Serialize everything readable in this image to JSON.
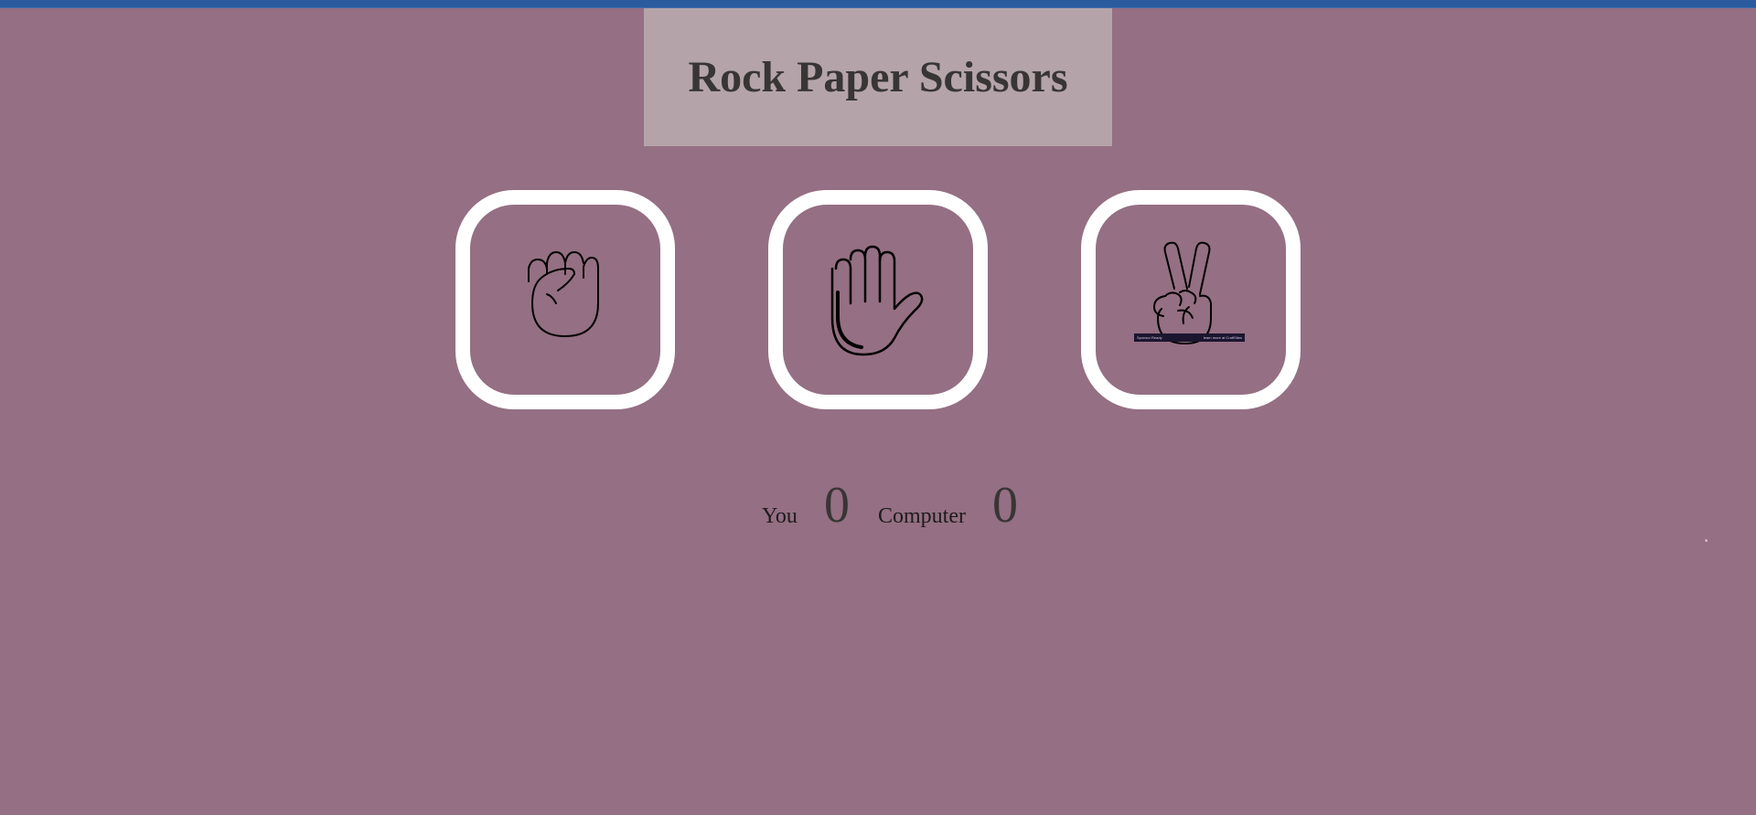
{
  "header": {
    "title": "Rock Paper Scissors"
  },
  "choices": [
    {
      "id": "rock",
      "icon": "raised-fist-icon"
    },
    {
      "id": "paper",
      "icon": "raised-hand-icon"
    },
    {
      "id": "scissors",
      "icon": "victory-hand-icon"
    }
  ],
  "sponsor": {
    "left_text": "Sponsor Ready",
    "right_text": "learn more at CraftSites"
  },
  "score": {
    "you_label": "You",
    "you_value": "0",
    "computer_label": "Computer",
    "computer_value": "0"
  },
  "colors": {
    "background": "#956f83",
    "title_panel": "#b4a4aa",
    "title_text": "#383535",
    "choice_border": "#ffffff",
    "top_strip": "#2a5b9f"
  }
}
